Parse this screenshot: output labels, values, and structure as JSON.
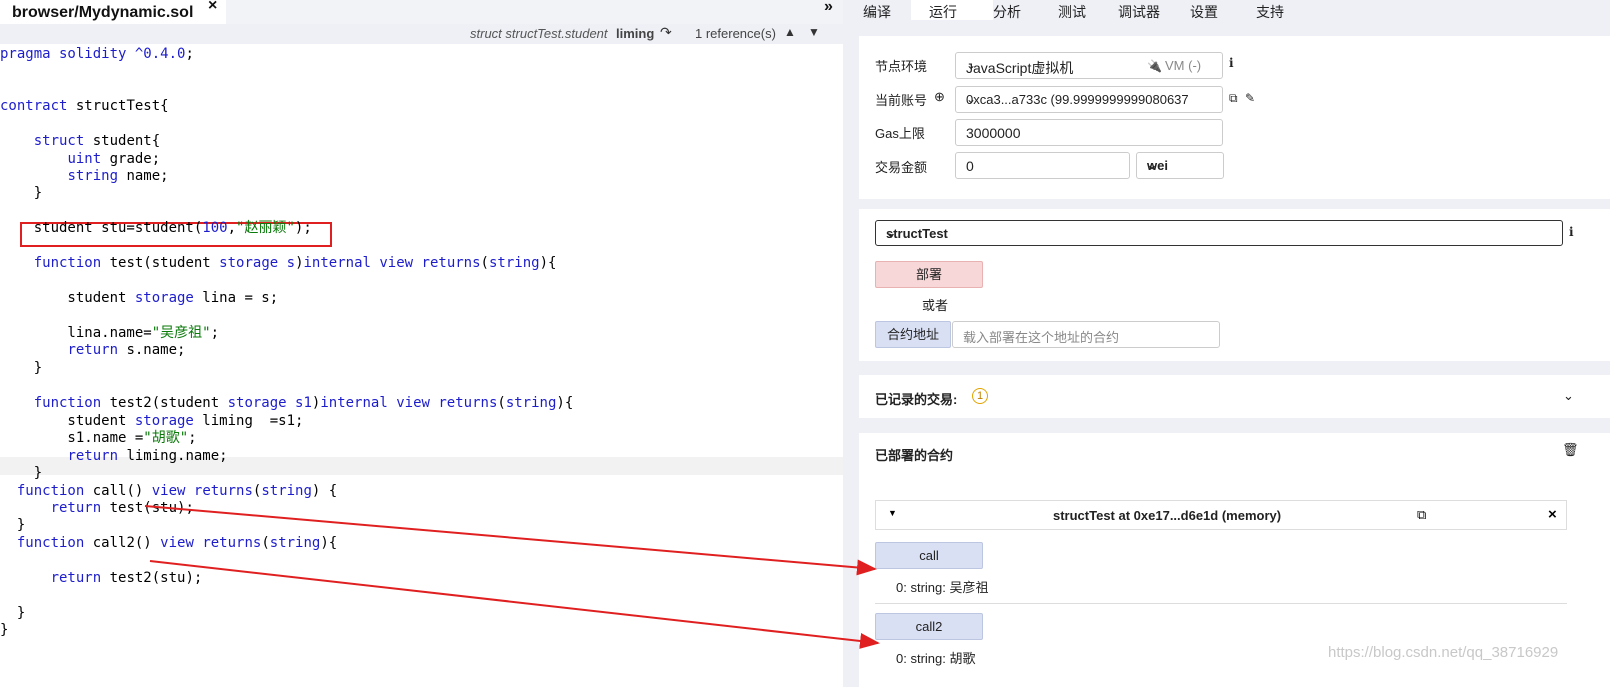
{
  "editor": {
    "tab_title": "browser/Mydynamic.sol",
    "tab_close": "×",
    "tab_more": "»",
    "info": {
      "struct_label": "struct structTest.student",
      "name": "liming",
      "goto_icon": "↷",
      "references": "1 reference(s)",
      "up_icon": "▲",
      "down_icon": "▼"
    },
    "code": {
      "l1_a": "pragma solidity ",
      "l1_b": "^0.4.0",
      "l1_c": ";",
      "l4_a": "contract",
      "l4_b": " structTest{",
      "l6_a": "    ",
      "l6_b": "struct",
      "l6_c": " student{",
      "l7_a": "        ",
      "l7_b": "uint",
      "l7_c": " grade;",
      "l8_a": "        ",
      "l8_b": "string",
      "l8_c": " name;",
      "l9": "    }",
      "l11_a": "    student stu=student(",
      "l11_b": "100",
      "l11_c": ",",
      "l11_d": "\"赵丽颖\"",
      "l11_e": ");",
      "l13_a": "    ",
      "l13_b": "function",
      "l13_c": " test(student ",
      "l13_d": "storage",
      "l13_e": " ",
      "l13_f": "s",
      "l13_g": ")",
      "l13_h": "internal",
      "l13_i": " ",
      "l13_j": "view",
      "l13_k": " ",
      "l13_l": "returns",
      "l13_m": "(",
      "l13_n": "string",
      "l13_o": "){",
      "l15_a": "        student ",
      "l15_b": "storage",
      "l15_c": " lina = s;",
      "l17_a": "        lina.name=",
      "l17_b": "\"吴彦祖\"",
      "l17_c": ";",
      "l18_a": "        ",
      "l18_b": "return",
      "l18_c": " s.name;",
      "l19": "    }",
      "l21_a": "    ",
      "l21_b": "function",
      "l21_c": " test2(student ",
      "l21_d": "storage",
      "l21_e": " ",
      "l21_f": "s1",
      "l21_g": ")",
      "l21_h": "internal",
      "l21_i": " ",
      "l21_j": "view",
      "l21_k": " ",
      "l21_l": "returns",
      "l21_m": "(",
      "l21_n": "string",
      "l21_o": "){",
      "l22_a": "        student ",
      "l22_b": "storage",
      "l22_c": " liming  =s1;",
      "l23_a": "        s1.name =",
      "l23_b": "\"胡歌\"",
      "l23_c": ";",
      "l24_a": "        ",
      "l24_b": "return",
      "l24_c": " liming.name;",
      "l25": "    }",
      "l26_a": "  ",
      "l26_b": "function",
      "l26_c": " call() ",
      "l26_d": "view",
      "l26_e": " ",
      "l26_f": "returns",
      "l26_g": "(",
      "l26_h": "string",
      "l26_i": ") {",
      "l27_a": "      ",
      "l27_b": "return",
      "l27_c": " test(stu);",
      "l28": "  }",
      "l29_a": "  ",
      "l29_b": "function",
      "l29_c": " call2() ",
      "l29_d": "view",
      "l29_e": " ",
      "l29_f": "returns",
      "l29_g": "(",
      "l29_h": "string",
      "l29_i": "){",
      "l31_a": "      ",
      "l31_b": "return",
      "l31_c": " test2(stu);",
      "l33": "  }",
      "l34": "}"
    }
  },
  "right_panel": {
    "tabs": [
      "编译",
      "运行",
      "分析",
      "测试",
      "调试器",
      "设置",
      "支持"
    ],
    "active_tab": "运行",
    "env": {
      "env_label": "节点环境",
      "env_value": "JavaScript虚拟机",
      "env_vm": "VM (-)",
      "info_icon": "i",
      "account_label": "当前账号",
      "account_value": "0xca3...a733c (99.9999999999080637",
      "gas_label": "Gas上限",
      "gas_value": "3000000",
      "value_label": "交易金额",
      "value_amount": "0",
      "value_unit": "wei"
    },
    "deploy": {
      "contract_select": "structTest",
      "deploy_button": "部署",
      "or_text": "或者",
      "at_address_button": "合约地址",
      "at_address_placeholder": "载入部署在这个地址的合约"
    },
    "transactions": {
      "label": "已记录的交易:",
      "count": "1"
    },
    "deployed": {
      "label": "已部署的合约",
      "instance_title": "structTest at 0xe17...d6e1d (memory)",
      "call_button": "call",
      "call_result": "0: string: 吴彦祖",
      "call2_button": "call2",
      "call2_result": "0: string: 胡歌"
    }
  },
  "watermark": "https://blog.csdn.net/qq_38716929",
  "colors": {
    "annotation_red": "#e02020",
    "keyword_blue": "#1d1dcc",
    "string_green": "#0a7a0a",
    "deploy_red": "#f7d7d7",
    "call_blue": "#d9e0f3"
  }
}
